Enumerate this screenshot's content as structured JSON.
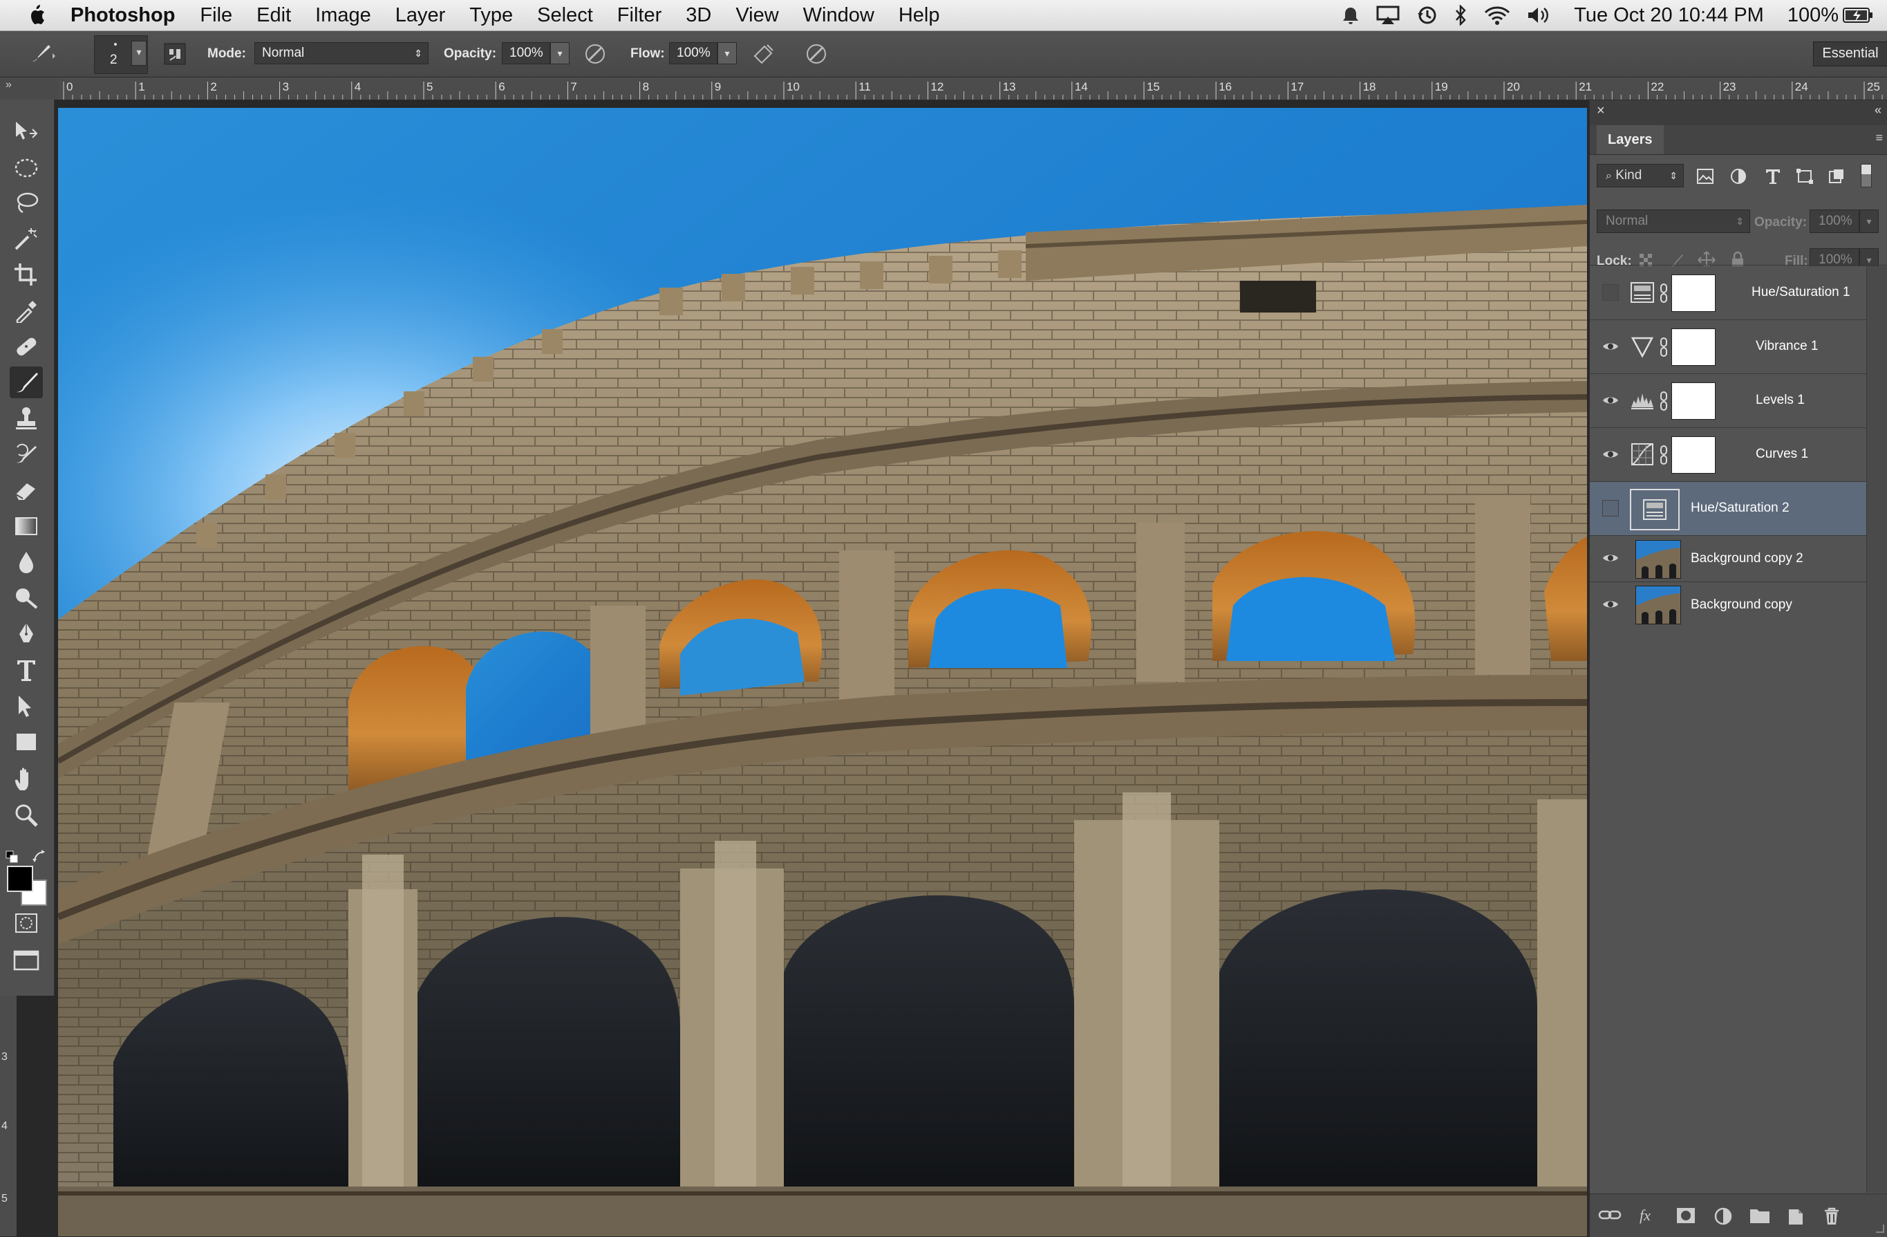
{
  "menubar": {
    "app_name": "Photoshop",
    "items": [
      "File",
      "Edit",
      "Image",
      "Layer",
      "Type",
      "Select",
      "Filter",
      "3D",
      "View",
      "Window",
      "Help"
    ],
    "clock": "Tue Oct 20  10:44 PM",
    "battery": "100%"
  },
  "options_bar": {
    "brush_size": "2",
    "mode_label": "Mode:",
    "mode_value": "Normal",
    "opacity_label": "Opacity:",
    "opacity_value": "100%",
    "flow_label": "Flow:",
    "flow_value": "100%",
    "workspace": "Essential"
  },
  "ruler": {
    "ticks": [
      "0",
      "1",
      "2",
      "3",
      "4",
      "5",
      "6",
      "7",
      "8",
      "9",
      "10",
      "11",
      "12",
      "13",
      "14",
      "15",
      "16",
      "17",
      "18",
      "19",
      "20",
      "21",
      "22",
      "23",
      "24",
      "25"
    ],
    "vertical_ticks": [
      "3",
      "4",
      "5"
    ]
  },
  "toolbar": {
    "tools": [
      "move-tool",
      "marquee-tool",
      "lasso-tool",
      "magic-wand-tool",
      "crop-tool",
      "eyedropper-tool",
      "healing-brush-tool",
      "brush-tool",
      "clone-stamp-tool",
      "history-brush-tool",
      "eraser-tool",
      "gradient-tool",
      "blur-tool",
      "dodge-tool",
      "pen-tool",
      "type-tool",
      "path-selection-tool",
      "rectangle-tool",
      "hand-tool",
      "zoom-tool"
    ],
    "selected_tool": "brush-tool",
    "foreground_color": "#000000",
    "background_color": "#ffffff"
  },
  "layers_panel": {
    "title": "Layers",
    "filter_kind": "Kind",
    "blend_mode": "Normal",
    "opacity_label": "Opacity:",
    "opacity_value": "100%",
    "lock_label": "Lock:",
    "fill_label": "Fill:",
    "fill_value": "100%",
    "layers": [
      {
        "name": "Hue/Saturation 1",
        "visible": false,
        "type": "hue-saturation",
        "has_mask": true,
        "active": false
      },
      {
        "name": "Vibrance 1",
        "visible": true,
        "type": "vibrance",
        "has_mask": true,
        "active": false
      },
      {
        "name": "Levels 1",
        "visible": true,
        "type": "levels",
        "has_mask": true,
        "active": false
      },
      {
        "name": "Curves 1",
        "visible": true,
        "type": "curves",
        "has_mask": true,
        "active": false
      },
      {
        "name": "Hue/Saturation 2",
        "visible": false,
        "type": "hue-saturation",
        "has_mask": false,
        "active": true
      },
      {
        "name": "Background copy 2",
        "visible": true,
        "type": "image",
        "has_mask": false,
        "active": false
      },
      {
        "name": "Background copy",
        "visible": true,
        "type": "image",
        "has_mask": false,
        "active": false
      }
    ],
    "footer_buttons": [
      "link-icon",
      "fx-icon",
      "mask-icon",
      "adjustment-icon",
      "folder-icon",
      "new-layer-icon",
      "trash-icon"
    ]
  },
  "document": {
    "image_subject": "colosseum-photo"
  }
}
